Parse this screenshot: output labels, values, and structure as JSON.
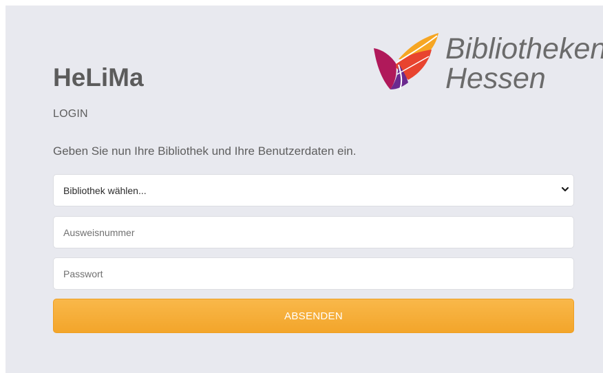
{
  "brand": {
    "logo_line1": "Bibliotheken",
    "logo_line2": "Hessen",
    "colors": [
      "#f6a623",
      "#e8442f",
      "#b0195a",
      "#6b2a8f"
    ]
  },
  "login": {
    "title": "HeLiMa",
    "subtitle": "LOGIN",
    "instruction": "Geben Sie nun Ihre Bibliothek und Ihre Benutzerdaten ein.",
    "library_select": {
      "selected": "Bibliothek wählen...",
      "icon": "chevron-down-icon"
    },
    "card_number": {
      "placeholder": "Ausweisnummer",
      "value": ""
    },
    "password": {
      "placeholder": "Passwort",
      "value": ""
    },
    "submit_label": "ABSENDEN"
  },
  "colors": {
    "background": "#e8e9ef",
    "accent": "#f6ab35",
    "text": "#5e5e5e"
  }
}
